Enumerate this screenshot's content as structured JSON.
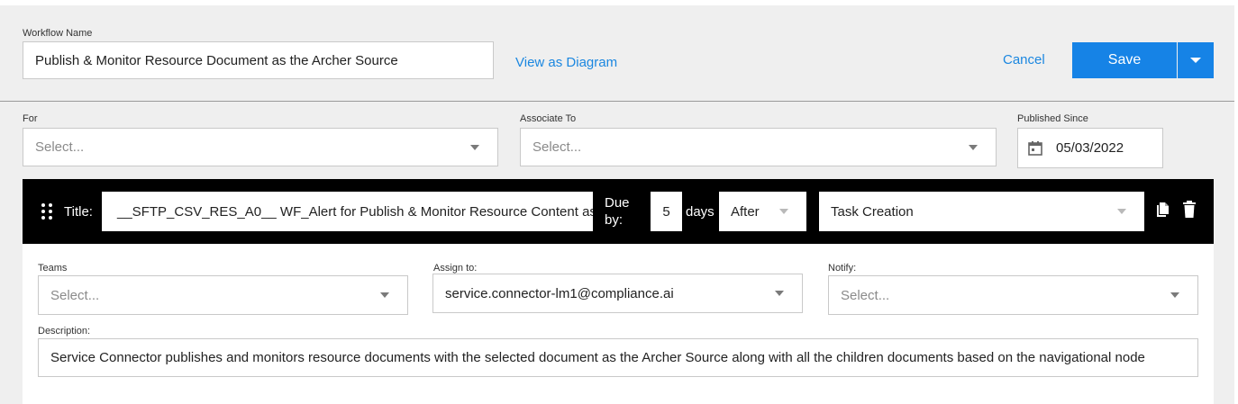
{
  "header": {
    "workflow_name_label": "Workflow Name",
    "workflow_name_value": "Publish & Monitor Resource Document as the Archer Source",
    "view_diagram_link": "View as Diagram",
    "cancel_label": "Cancel",
    "save_label": "Save"
  },
  "filters": {
    "for_label": "For",
    "for_placeholder": "Select...",
    "associate_label": "Associate To",
    "associate_placeholder": "Select...",
    "published_label": "Published Since",
    "published_value": "05/03/2022"
  },
  "task": {
    "title_label": "Title:",
    "title_value": "__SFTP_CSV_RES_A0__ WF_Alert for Publish & Monitor Resource Content as",
    "due_label_line1": "Due",
    "due_label_line2": "by:",
    "due_value": "5",
    "days_label": "days",
    "timing_value": "After",
    "trigger_value": "Task Creation",
    "teams_label": "Teams",
    "teams_placeholder": "Select...",
    "assign_label": "Assign to:",
    "assign_value": "service.connector-lm1@compliance.ai",
    "notify_label": "Notify:",
    "notify_placeholder": "Select...",
    "description_label": "Description:",
    "description_value": "Service Connector publishes and monitors resource documents with the selected document as the Archer Source along with all the children documents based on the navigational node"
  },
  "colors": {
    "accent": "#1683e6",
    "link": "#1b87e0",
    "task_bar": "#000000",
    "panel_bg": "#efefef"
  },
  "icons": [
    "calendar-icon",
    "drag-handle-icon",
    "copy-icon",
    "trash-icon",
    "chevron-down-icon"
  ]
}
